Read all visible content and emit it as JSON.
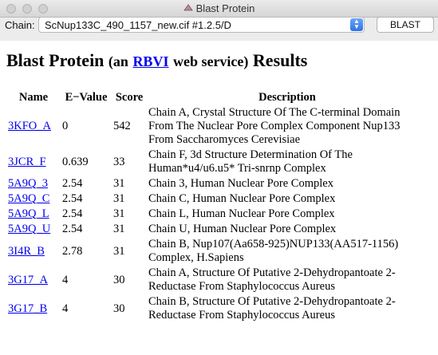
{
  "window": {
    "title": "Blast Protein"
  },
  "toolbar": {
    "chain_label": "Chain:",
    "chain_value": "ScNup133C_490_1157_new.cif #1.2.5/D",
    "blast_button": "BLAST"
  },
  "results": {
    "heading_main": "Blast Protein",
    "heading_an": "(an",
    "heading_link": "RBVI",
    "heading_service": "web service)",
    "heading_results": "Results",
    "columns": [
      "Name",
      "E−Value",
      "Score",
      "Description"
    ],
    "rows": [
      {
        "name": "3KFO_A",
        "evalue": "0",
        "score": "542",
        "description": "Chain A, Crystal Structure Of The C-terminal Domain From The Nuclear Pore Complex Component Nup133 From Saccharomyces Cerevisiae"
      },
      {
        "name": "3JCR_F",
        "evalue": "0.639",
        "score": "33",
        "description": "Chain F, 3d Structure Determination Of The Human*u4/u6.u5* Tri-snrnp Complex"
      },
      {
        "name": "5A9Q_3",
        "evalue": "2.54",
        "score": "31",
        "description": "Chain 3, Human Nuclear Pore Complex"
      },
      {
        "name": "5A9Q_C",
        "evalue": "2.54",
        "score": "31",
        "description": "Chain C, Human Nuclear Pore Complex"
      },
      {
        "name": "5A9Q_L",
        "evalue": "2.54",
        "score": "31",
        "description": "Chain L, Human Nuclear Pore Complex"
      },
      {
        "name": "5A9Q_U",
        "evalue": "2.54",
        "score": "31",
        "description": "Chain U, Human Nuclear Pore Complex"
      },
      {
        "name": "3I4R_B",
        "evalue": "2.78",
        "score": "31",
        "description": "Chain B, Nup107(Aa658-925)NUP133(AA517-1156) Complex, H.Sapiens"
      },
      {
        "name": "3G17_A",
        "evalue": "4",
        "score": "30",
        "description": "Chain A, Structure Of Putative 2-Dehydropantoate 2-Reductase From Staphylococcus Aureus"
      },
      {
        "name": "3G17_B",
        "evalue": "4",
        "score": "30",
        "description": "Chain B, Structure Of Putative 2-Dehydropantoate 2-Reductase From Staphylococcus Aureus"
      }
    ]
  }
}
